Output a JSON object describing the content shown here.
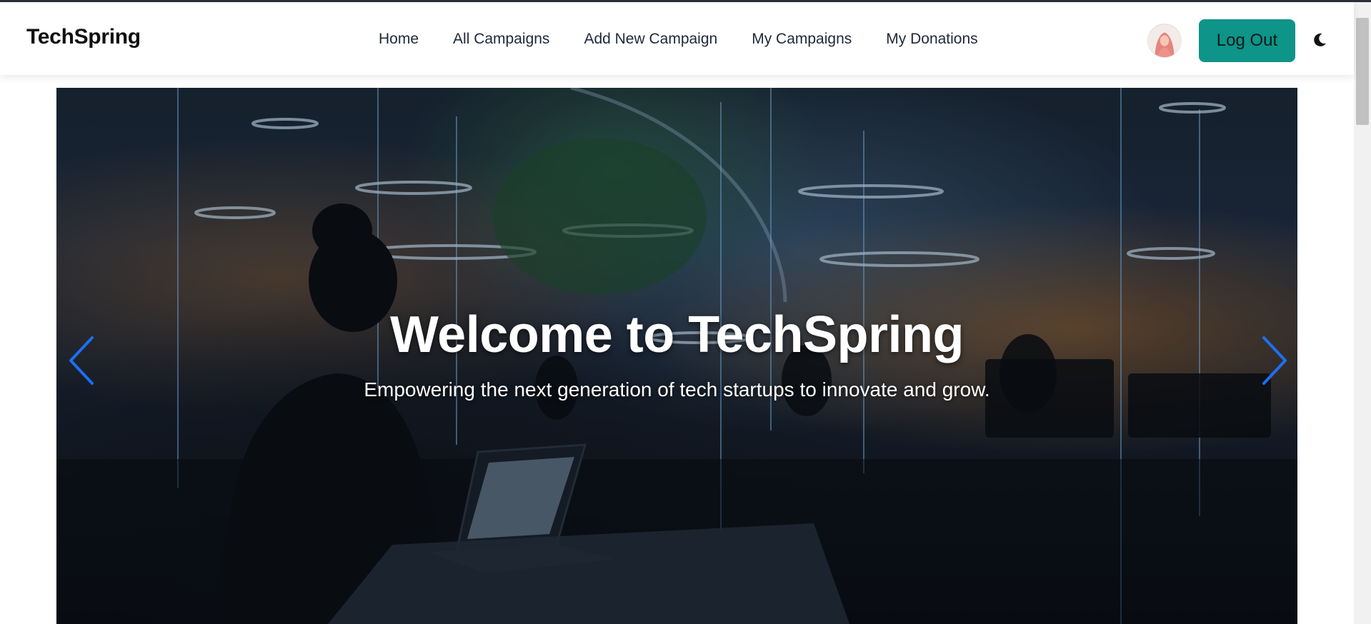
{
  "navbar": {
    "brand": "TechSpring",
    "links": [
      {
        "label": "Home"
      },
      {
        "label": "All Campaigns"
      },
      {
        "label": "Add New Campaign"
      },
      {
        "label": "My Campaigns"
      },
      {
        "label": "My Donations"
      }
    ],
    "logout_label": "Log Out",
    "avatar_icon": "user-avatar",
    "theme_icon": "moon-icon"
  },
  "hero": {
    "title": "Welcome to TechSpring",
    "subtitle": "Empowering the next generation of tech startups to innovate and grow.",
    "prev_icon": "chevron-left-icon",
    "next_icon": "chevron-right-icon"
  },
  "colors": {
    "accent": "#0e9488",
    "arrow": "#1d6ff2",
    "text_dark": "#111111"
  }
}
